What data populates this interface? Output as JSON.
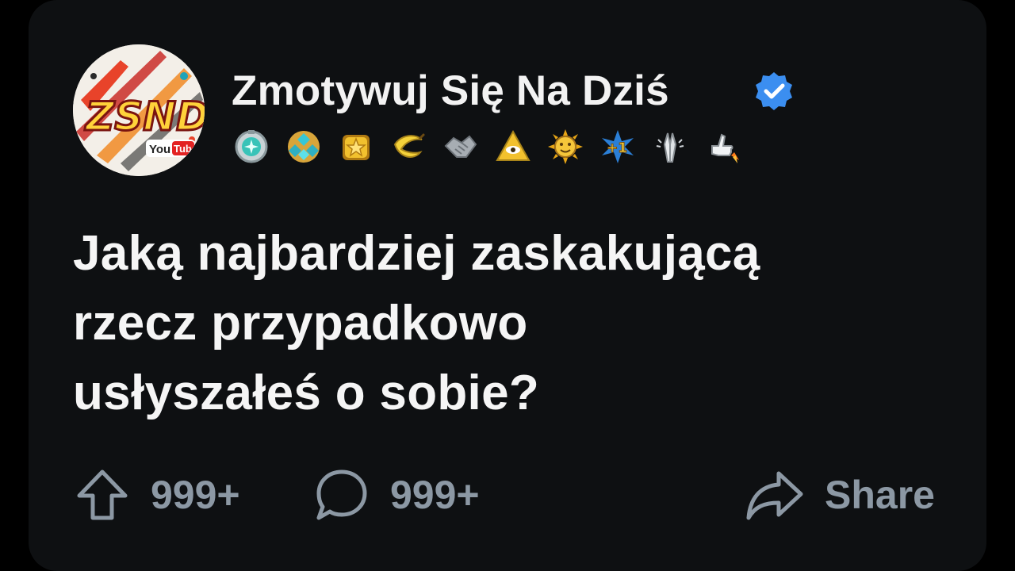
{
  "post": {
    "account_name": "Zmotywuj Się Na Dziś",
    "verified": true,
    "avatar": {
      "logo_text": "ZSND",
      "platform_tag": "YouTube"
    },
    "badges": [
      "spotlight-award-icon",
      "gem-cluster-award-icon",
      "gold-star-award-icon",
      "banana-award-icon",
      "handshake-award-icon",
      "pyramid-eye-award-icon",
      "sun-face-award-icon",
      "plus-one-award-icon",
      "praying-hands-award-icon",
      "thumbs-up-rocket-award-icon"
    ],
    "question_lines": [
      "Jaką najbardziej zaskakującą",
      "rzecz przypadkowo",
      "usłyszałeś o sobie?"
    ]
  },
  "actions": {
    "upvote_count": "999+",
    "comment_count": "999+",
    "share_label": "Share"
  },
  "colors": {
    "background": "#000000",
    "card": "#0e1012",
    "text": "#f2f2f2",
    "muted": "#8c98a4",
    "verified": "#3b8ef0"
  }
}
